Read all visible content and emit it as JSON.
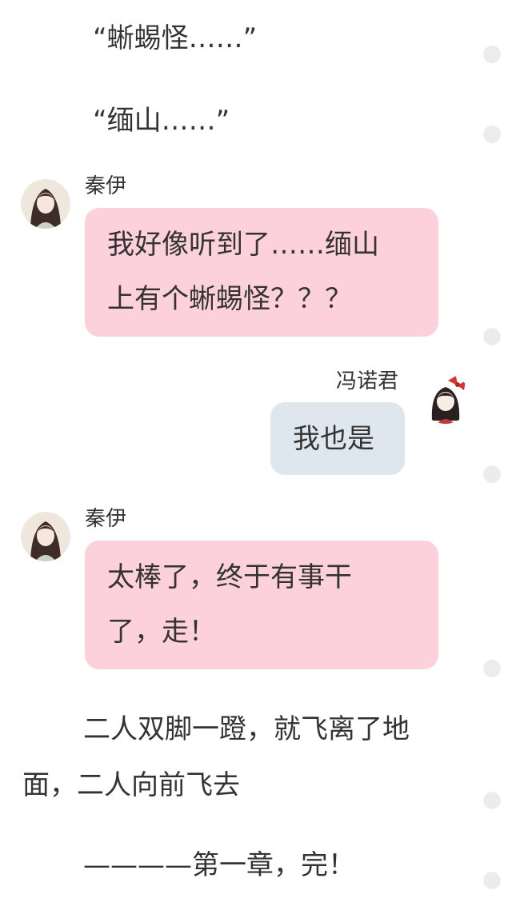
{
  "narration_top": [
    "“蜥蜴怪……”",
    "“缅山……”"
  ],
  "messages": [
    {
      "speaker": "秦伊",
      "lines": [
        "我好像听到了……缅山",
        "上有个蜥蜴怪？？？"
      ]
    },
    {
      "speaker": "冯诺君",
      "lines": [
        "我也是"
      ]
    },
    {
      "speaker": "秦伊",
      "lines": [
        "太棒了，终于有事干",
        "了，走！"
      ]
    }
  ],
  "narration_bottom": [
    "二人双脚一蹬，就飞离了地",
    "面，二人向前飞去"
  ],
  "chapter_end": "————第一章，完！",
  "colors": {
    "pink_bubble": "#fdd1dc",
    "grey_bubble": "#dfe7ee",
    "text": "#333333",
    "scroll_dot": "#ececec"
  },
  "icons": [
    "qin-yi-avatar",
    "feng-nuo-jun-avatar",
    "scroll-dot"
  ]
}
